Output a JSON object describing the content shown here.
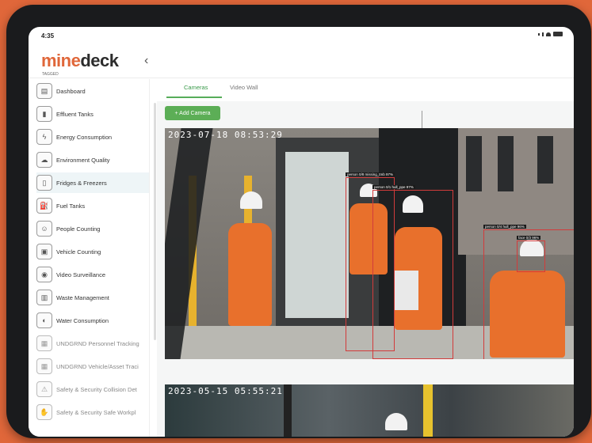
{
  "status": {
    "time": "4:35"
  },
  "header": {
    "logo_part1": "mine",
    "logo_part2": "deck",
    "logo_sub": "TAGGED",
    "back_icon": "chevron-left-icon"
  },
  "sidebar": {
    "items": [
      {
        "label": "Dashboard",
        "icon": "dashboard-icon"
      },
      {
        "label": "Effluent Tanks",
        "icon": "tank-icon"
      },
      {
        "label": "Energy Consumption",
        "icon": "energy-icon"
      },
      {
        "label": "Environment Quality",
        "icon": "environment-icon"
      },
      {
        "label": "Fridges & Freezers",
        "icon": "fridge-icon"
      },
      {
        "label": "Fuel Tanks",
        "icon": "fuel-icon"
      },
      {
        "label": "People Counting",
        "icon": "people-icon"
      },
      {
        "label": "Vehicle Counting",
        "icon": "vehicle-icon"
      },
      {
        "label": "Video Surveillance",
        "icon": "camera-icon"
      },
      {
        "label": "Waste Management",
        "icon": "waste-icon"
      },
      {
        "label": "Water Consumption",
        "icon": "water-icon"
      },
      {
        "label": "UNDGRND Personnel Tracking",
        "icon": "personnel-icon"
      },
      {
        "label": "UNDGRND Vehicle/Asset Traci",
        "icon": "asset-icon"
      },
      {
        "label": "Safety & Security Collision Det",
        "icon": "collision-icon"
      },
      {
        "label": "Safety & Security Safe Workpl",
        "icon": "workplace-icon"
      }
    ]
  },
  "main": {
    "tabs": [
      {
        "label": "Cameras"
      },
      {
        "label": "Video Wall"
      }
    ],
    "add_button": "+ Add Camera",
    "cameras": [
      {
        "timestamp": "2023-07-18 08:53:29",
        "detections": [
          "person 0/8 missing_tmb 97%",
          "person 0/1 hull_ppe 97%",
          "person 0/4 hull_ppe 96%",
          "face 0/3 96%"
        ]
      },
      {
        "timestamp": "2023-05-15 05:55:21"
      }
    ]
  },
  "colors": {
    "brand": "#e0673a",
    "accent_green": "#5cae56"
  }
}
